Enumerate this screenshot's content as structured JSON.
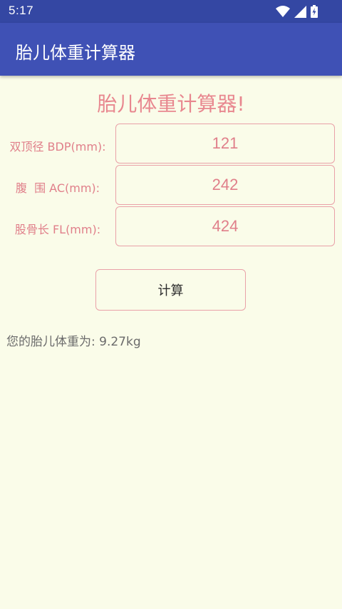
{
  "status_bar": {
    "time": "5:17",
    "icons": [
      "wifi-icon",
      "cell-signal-icon",
      "battery-charging-icon"
    ]
  },
  "app_bar": {
    "title": "胎儿体重计算器"
  },
  "form": {
    "heading": "胎儿体重计算器!",
    "fields": [
      {
        "label": "双顶径 BDP(mm):",
        "value": "121"
      },
      {
        "label": "腹  围 AC(mm):",
        "value": "242"
      },
      {
        "label": "股骨长 FL(mm):",
        "value": "424"
      }
    ],
    "calculate_label": "计算"
  },
  "result": {
    "label": "您的胎儿体重为:",
    "value": " 9.27kg"
  },
  "colors": {
    "status_bar": "#3447a3",
    "app_bar": "#3f51b5",
    "background": "#fafce9",
    "accent_pink": "#e07f8a",
    "border_pink": "#e9a1a8"
  }
}
